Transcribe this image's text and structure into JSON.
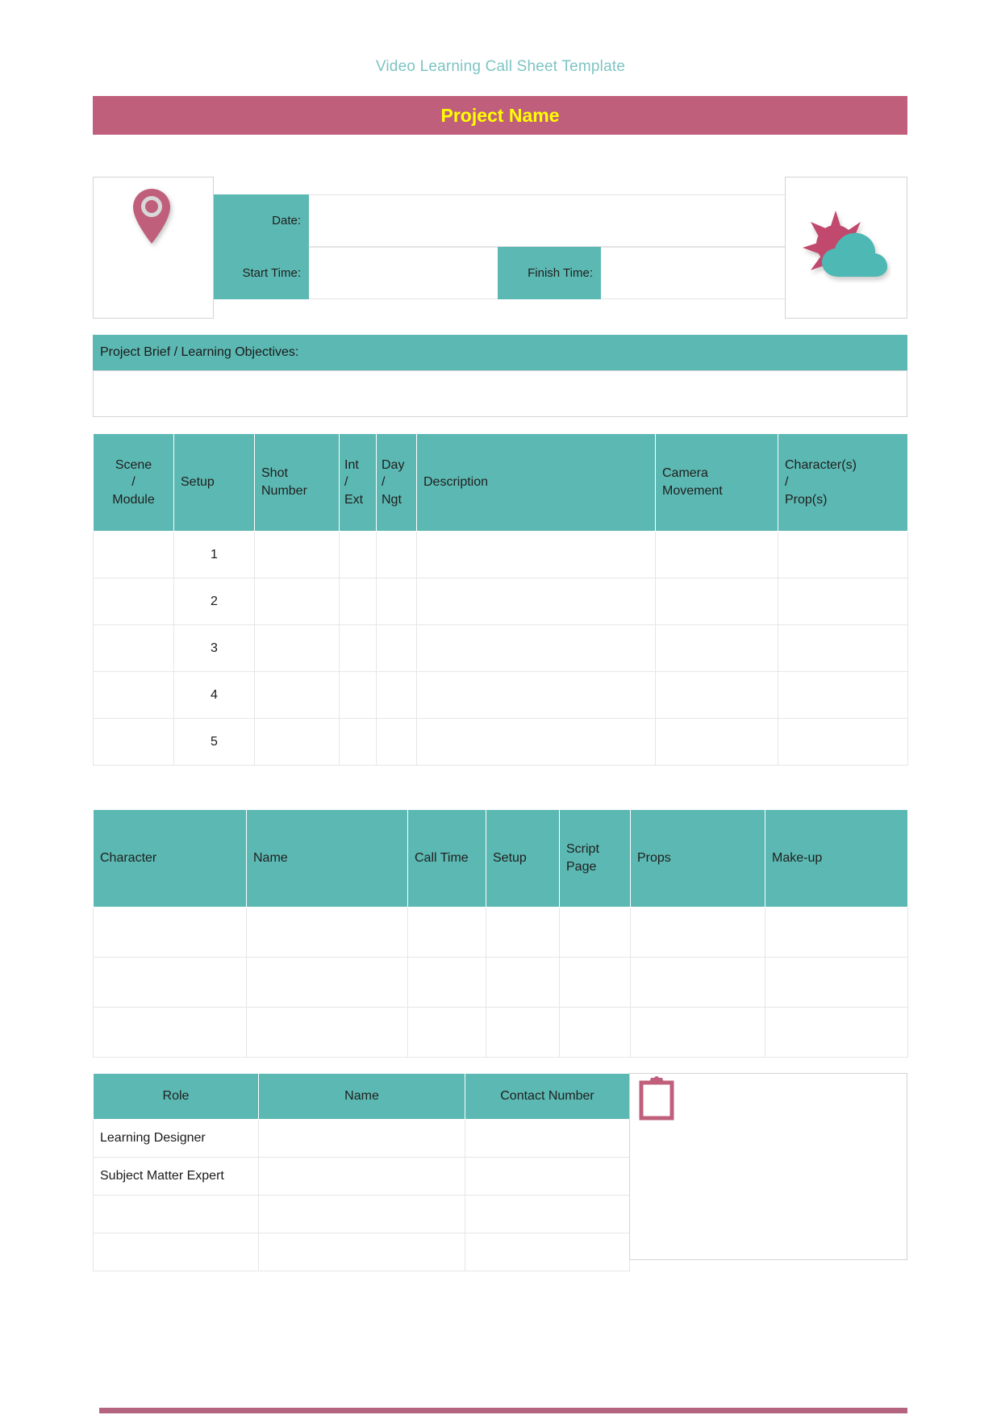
{
  "document": {
    "title": "Video Learning Call Sheet Template",
    "project_name": "Project Name"
  },
  "icons": {
    "location_pin": "location-pin-icon",
    "weather": "sun-cloud-icon",
    "clipboard": "clipboard-icon"
  },
  "colors": {
    "teal": "#5cb8b2",
    "teal_light": "#7ec4c4",
    "rose": "#c05f7c",
    "rose_dark": "#b5647f",
    "yellow": "#ffff00",
    "border": "#d4d4d4"
  },
  "info": {
    "date_label": "Date:",
    "date_value": "",
    "start_time_label": "Start Time:",
    "start_time_value": "",
    "finish_time_label": "Finish Time:",
    "finish_time_value": ""
  },
  "brief": {
    "heading": "Project Brief / Learning Objectives:",
    "body": ""
  },
  "shot_table": {
    "headers": [
      "Scene\n/\nModule",
      "Setup",
      "Shot\nNumber",
      "Int\n/\nExt",
      "Day\n/\nNgt",
      "Description",
      "Camera\nMovement",
      "Character(s)\n/\n Prop(s)"
    ],
    "rows": [
      {
        "scene": "",
        "setup": "1",
        "shot_number": "",
        "int_ext": "",
        "day_ngt": "",
        "description": "",
        "camera_movement": "",
        "characters_props": ""
      },
      {
        "scene": "",
        "setup": "2",
        "shot_number": "",
        "int_ext": "",
        "day_ngt": "",
        "description": "",
        "camera_movement": "",
        "characters_props": ""
      },
      {
        "scene": "",
        "setup": "3",
        "shot_number": "",
        "int_ext": "",
        "day_ngt": "",
        "description": "",
        "camera_movement": "",
        "characters_props": ""
      },
      {
        "scene": "",
        "setup": "4",
        "shot_number": "",
        "int_ext": "",
        "day_ngt": "",
        "description": "",
        "camera_movement": "",
        "characters_props": ""
      },
      {
        "scene": "",
        "setup": "5",
        "shot_number": "",
        "int_ext": "",
        "day_ngt": "",
        "description": "",
        "camera_movement": "",
        "characters_props": ""
      }
    ]
  },
  "cast_table": {
    "headers": [
      "Character",
      "Name",
      "Call Time",
      "Setup",
      "Script\nPage",
      "Props",
      "Make-up"
    ],
    "rows": [
      {
        "character": "",
        "name": "",
        "call_time": "",
        "setup": "",
        "script_page": "",
        "props": "",
        "make_up": ""
      },
      {
        "character": "",
        "name": "",
        "call_time": "",
        "setup": "",
        "script_page": "",
        "props": "",
        "make_up": ""
      },
      {
        "character": "",
        "name": "",
        "call_time": "",
        "setup": "",
        "script_page": "",
        "props": "",
        "make_up": ""
      }
    ]
  },
  "contacts_table": {
    "headers": [
      "Role",
      "Name",
      "Contact Number"
    ],
    "rows": [
      {
        "role": "Learning Designer",
        "name": "",
        "contact_number": ""
      },
      {
        "role": "Subject Matter Expert",
        "name": "",
        "contact_number": ""
      },
      {
        "role": "",
        "name": "",
        "contact_number": ""
      },
      {
        "role": "",
        "name": "",
        "contact_number": ""
      }
    ]
  },
  "notes": {
    "body": ""
  }
}
